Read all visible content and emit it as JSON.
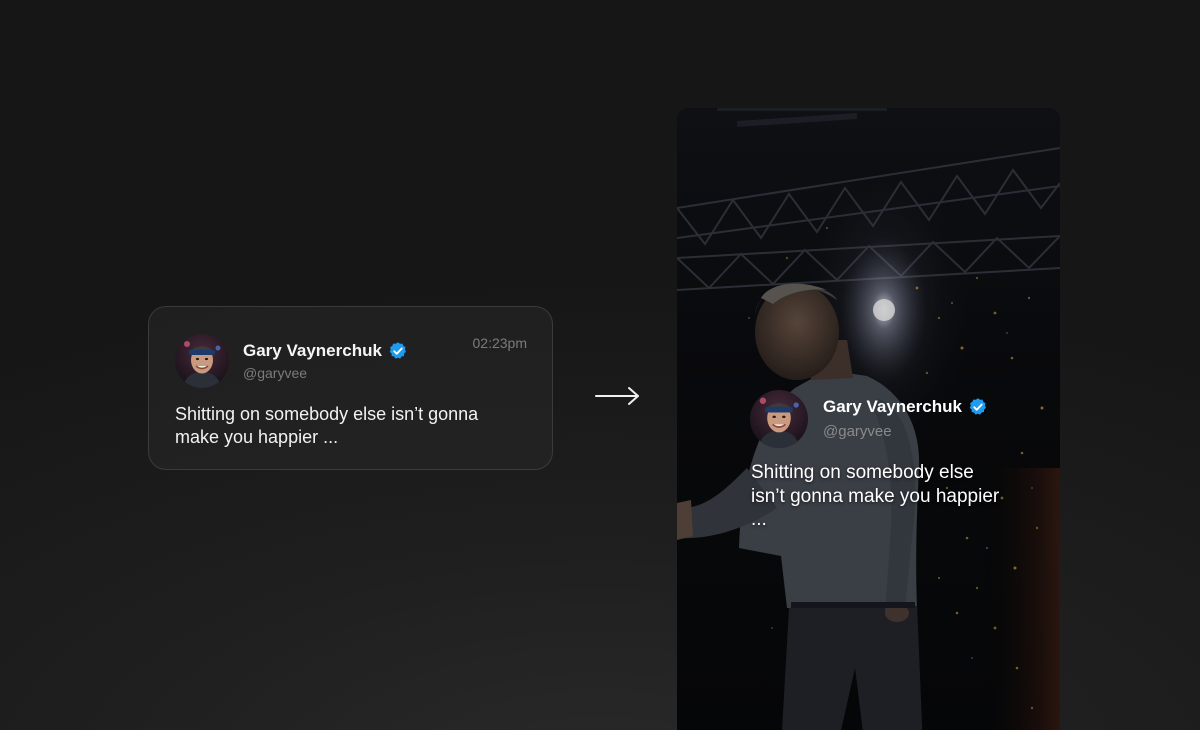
{
  "tweet": {
    "author_name": "Gary Vaynerchuk",
    "handle": "@garyvee",
    "timestamp": "02:23pm",
    "text": "Shitting on somebody else isn’t gonna make you happier ...",
    "verified": true,
    "verified_color": "#1d9bf0"
  },
  "story": {
    "author_name": "Gary Vaynerchuk",
    "handle": "@garyvee",
    "text": "Shitting on somebody else isn’t gonna make you happier ...",
    "verified": true
  },
  "icons": {
    "arrow": "arrow-right-icon",
    "verified": "verified-badge-icon"
  }
}
